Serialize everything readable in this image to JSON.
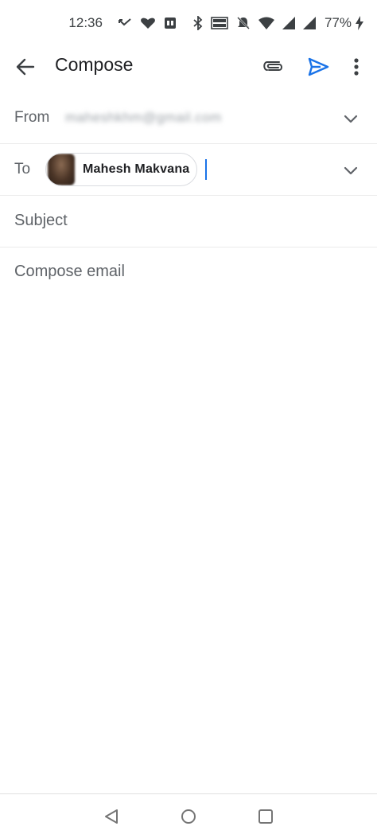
{
  "status_bar": {
    "time": "12:36",
    "battery_percent": "77%",
    "icons": [
      "missed-call-icon",
      "heart-icon",
      "media-icon",
      "bluetooth-icon",
      "volte-icon",
      "notifications-off-icon",
      "wifi-icon",
      "signal-icon",
      "signal-icon-2",
      "charging-icon"
    ]
  },
  "app_bar": {
    "title": "Compose",
    "icons": [
      "back-arrow-icon",
      "attachment-icon",
      "send-icon",
      "more-vert-icon"
    ],
    "accent_color": "#1a73e8"
  },
  "from": {
    "label": "From",
    "value": "maheshkhm@gmail.com"
  },
  "to": {
    "label": "To",
    "recipients": [
      {
        "name": "Mahesh Makvana"
      }
    ]
  },
  "subject": {
    "placeholder": "Subject"
  },
  "body": {
    "placeholder": "Compose email"
  },
  "nav_bar": {
    "icons": [
      "nav-back-icon",
      "nav-home-icon",
      "nav-recents-icon"
    ]
  }
}
